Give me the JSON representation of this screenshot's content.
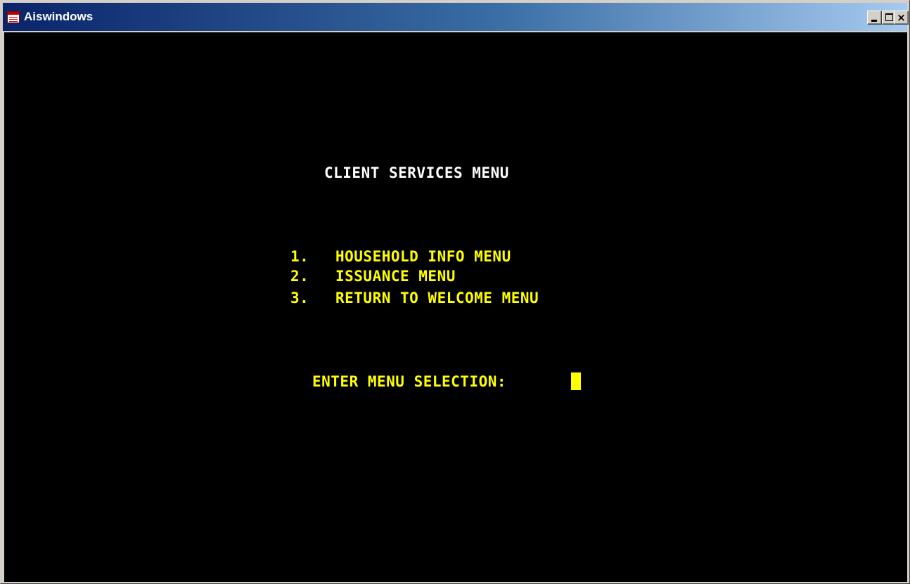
{
  "window": {
    "title": "Aiswindows",
    "controls": {
      "minimize": "minimize",
      "maximize": "maximize",
      "close": "×"
    }
  },
  "screen": {
    "heading": "CLIENT SERVICES MENU",
    "menu_items": [
      {
        "number": "1.",
        "label": "HOUSEHOLD INFO MENU"
      },
      {
        "number": "2.",
        "label": "ISSUANCE MENU"
      },
      {
        "number": "3.",
        "label": "RETURN TO WELCOME MENU"
      }
    ],
    "prompt": "ENTER MENU SELECTION:",
    "input_value": ""
  },
  "colors": {
    "background": "#000000",
    "heading": "#ffffff",
    "menu_text": "#ffff00",
    "cursor": "#ffff00"
  }
}
